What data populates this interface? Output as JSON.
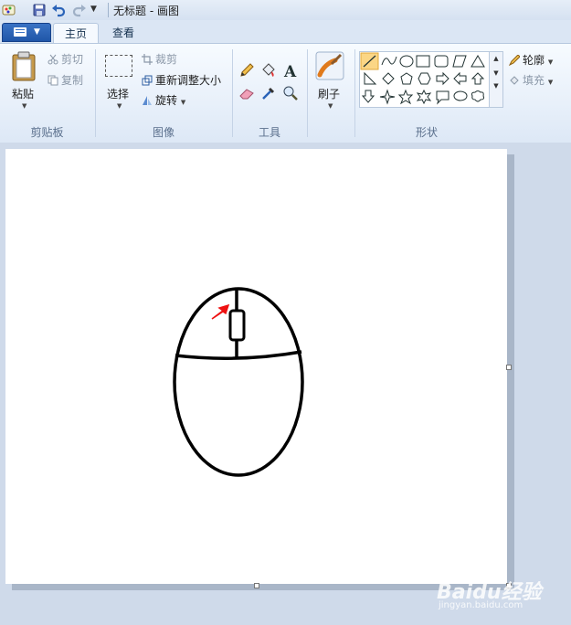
{
  "titlebar": {
    "title": "无标题 - 画图",
    "icons": [
      "paint-app-icon",
      "save-icon",
      "undo-icon",
      "redo-icon",
      "customize-chevron-icon"
    ]
  },
  "tabs": {
    "home": "主页",
    "view": "查看"
  },
  "clipboard": {
    "paste": "粘贴",
    "cut": "剪切",
    "copy": "复制",
    "label": "剪贴板"
  },
  "image": {
    "select": "选择",
    "crop": "裁剪",
    "resize": "重新调整大小",
    "rotate": "旋转",
    "label": "图像"
  },
  "tools": {
    "label": "工具",
    "items": [
      "pencil-icon",
      "fill-bucket-icon",
      "text-icon",
      "eraser-icon",
      "color-picker-icon",
      "magnifier-icon"
    ]
  },
  "brushes": {
    "label": "刷子"
  },
  "shapes": {
    "label": "形状",
    "outline": "轮廓",
    "fill": "填充"
  },
  "watermark": {
    "text": "Baidu经验",
    "sub": "jingyan.baidu.com"
  }
}
